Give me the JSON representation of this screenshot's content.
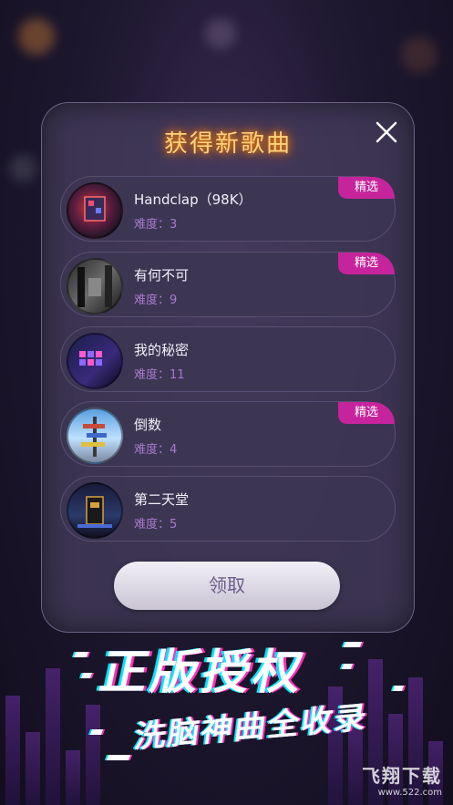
{
  "dialog": {
    "title": "获得新歌曲",
    "close_icon": "close-icon",
    "badge_label": "精选",
    "claim_label": "领取",
    "songs": [
      {
        "name": "Handclap（98K）",
        "difficulty": "难度：3",
        "featured": true
      },
      {
        "name": "有何不可",
        "difficulty": "难度：9",
        "featured": true
      },
      {
        "name": "我的秘密",
        "difficulty": "难度：11",
        "featured": false
      },
      {
        "name": "倒数",
        "difficulty": "难度：4",
        "featured": true
      },
      {
        "name": "第二天堂",
        "difficulty": "难度：5",
        "featured": false
      }
    ]
  },
  "promo": {
    "headline": "正版授权",
    "subline": "洗脑神曲全收录"
  },
  "watermark": {
    "logo_text": "飞翔下载",
    "url": "www.522.com"
  },
  "colors": {
    "title_glow": "#ffd27a",
    "badge": "#c6249c",
    "difficulty": "#a77ad0",
    "accent_cyan": "#00e6ff",
    "accent_pink": "#ff2fb9"
  }
}
